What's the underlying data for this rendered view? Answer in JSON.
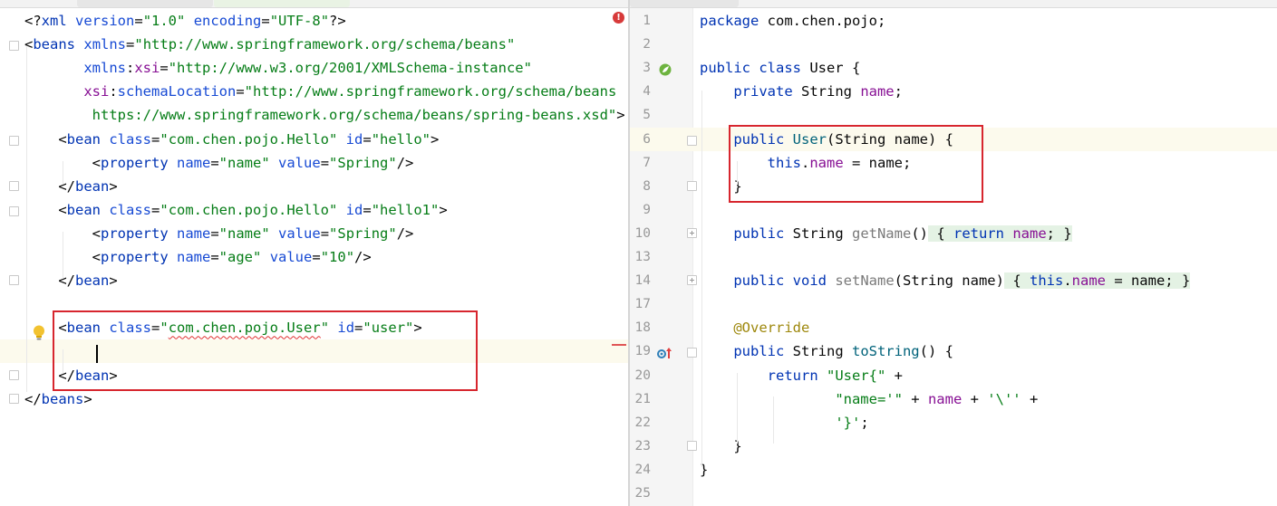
{
  "xml_editor": {
    "lines": [
      [
        {
          "t": "<?",
          "c": "x-bracket"
        },
        {
          "t": "xml",
          "c": "x-tag"
        },
        {
          "t": " ",
          "c": ""
        },
        {
          "t": "version",
          "c": "x-attr"
        },
        {
          "t": "=",
          "c": ""
        },
        {
          "t": "\"1.0\"",
          "c": "x-val"
        },
        {
          "t": " ",
          "c": ""
        },
        {
          "t": "encoding",
          "c": "x-attr"
        },
        {
          "t": "=",
          "c": ""
        },
        {
          "t": "\"UTF-8\"",
          "c": "x-val"
        },
        {
          "t": "?>",
          "c": "x-bracket"
        }
      ],
      [
        {
          "t": "<",
          "c": "x-bracket"
        },
        {
          "t": "beans",
          "c": "x-tag"
        },
        {
          "t": " ",
          "c": ""
        },
        {
          "t": "xmlns",
          "c": "x-attr"
        },
        {
          "t": "=",
          "c": ""
        },
        {
          "t": "\"http://www.springframework.org/schema/beans\"",
          "c": "x-val"
        }
      ],
      [
        {
          "t": "       ",
          "c": ""
        },
        {
          "t": "xmlns",
          "c": "x-attr"
        },
        {
          "t": ":",
          "c": ""
        },
        {
          "t": "xsi",
          "c": "x-ns"
        },
        {
          "t": "=",
          "c": ""
        },
        {
          "t": "\"http://www.w3.org/2001/XMLSchema-instance\"",
          "c": "x-val"
        }
      ],
      [
        {
          "t": "       ",
          "c": ""
        },
        {
          "t": "xsi",
          "c": "x-ns"
        },
        {
          "t": ":",
          "c": ""
        },
        {
          "t": "schemaLocation",
          "c": "x-attr"
        },
        {
          "t": "=",
          "c": ""
        },
        {
          "t": "\"http://www.springframework.org/schema/beans",
          "c": "x-val"
        }
      ],
      [
        {
          "t": "        ",
          "c": ""
        },
        {
          "t": "https://www.springframework.org/schema/beans/spring-beans.xsd\"",
          "c": "x-val"
        },
        {
          "t": ">",
          "c": "x-bracket"
        }
      ],
      [
        {
          "t": "    <",
          "c": "x-bracket"
        },
        {
          "t": "bean",
          "c": "x-tag"
        },
        {
          "t": " ",
          "c": ""
        },
        {
          "t": "class",
          "c": "x-attr"
        },
        {
          "t": "=",
          "c": ""
        },
        {
          "t": "\"com.chen.pojo.Hello\"",
          "c": "x-val"
        },
        {
          "t": " ",
          "c": ""
        },
        {
          "t": "id",
          "c": "x-attr"
        },
        {
          "t": "=",
          "c": ""
        },
        {
          "t": "\"hello\"",
          "c": "x-val"
        },
        {
          "t": ">",
          "c": "x-bracket"
        }
      ],
      [
        {
          "t": "        <",
          "c": "x-bracket"
        },
        {
          "t": "property",
          "c": "x-tag"
        },
        {
          "t": " ",
          "c": ""
        },
        {
          "t": "name",
          "c": "x-attr"
        },
        {
          "t": "=",
          "c": ""
        },
        {
          "t": "\"name\"",
          "c": "x-val"
        },
        {
          "t": " ",
          "c": ""
        },
        {
          "t": "value",
          "c": "x-attr"
        },
        {
          "t": "=",
          "c": ""
        },
        {
          "t": "\"Spring\"",
          "c": "x-val"
        },
        {
          "t": "/>",
          "c": "x-bracket"
        }
      ],
      [
        {
          "t": "    </",
          "c": "x-bracket"
        },
        {
          "t": "bean",
          "c": "x-tag"
        },
        {
          "t": ">",
          "c": "x-bracket"
        }
      ],
      [
        {
          "t": "    <",
          "c": "x-bracket"
        },
        {
          "t": "bean",
          "c": "x-tag"
        },
        {
          "t": " ",
          "c": ""
        },
        {
          "t": "class",
          "c": "x-attr"
        },
        {
          "t": "=",
          "c": ""
        },
        {
          "t": "\"com.chen.pojo.Hello\"",
          "c": "x-val"
        },
        {
          "t": " ",
          "c": ""
        },
        {
          "t": "id",
          "c": "x-attr"
        },
        {
          "t": "=",
          "c": ""
        },
        {
          "t": "\"hello1\"",
          "c": "x-val"
        },
        {
          "t": ">",
          "c": "x-bracket"
        }
      ],
      [
        {
          "t": "        <",
          "c": "x-bracket"
        },
        {
          "t": "property",
          "c": "x-tag"
        },
        {
          "t": " ",
          "c": ""
        },
        {
          "t": "name",
          "c": "x-attr"
        },
        {
          "t": "=",
          "c": ""
        },
        {
          "t": "\"name\"",
          "c": "x-val"
        },
        {
          "t": " ",
          "c": ""
        },
        {
          "t": "value",
          "c": "x-attr"
        },
        {
          "t": "=",
          "c": ""
        },
        {
          "t": "\"Spring\"",
          "c": "x-val"
        },
        {
          "t": "/>",
          "c": "x-bracket"
        }
      ],
      [
        {
          "t": "        <",
          "c": "x-bracket"
        },
        {
          "t": "property",
          "c": "x-tag"
        },
        {
          "t": " ",
          "c": ""
        },
        {
          "t": "name",
          "c": "x-attr"
        },
        {
          "t": "=",
          "c": ""
        },
        {
          "t": "\"age\"",
          "c": "x-val"
        },
        {
          "t": " ",
          "c": ""
        },
        {
          "t": "value",
          "c": "x-attr"
        },
        {
          "t": "=",
          "c": ""
        },
        {
          "t": "\"10\"",
          "c": "x-val"
        },
        {
          "t": "/>",
          "c": "x-bracket"
        }
      ],
      [
        {
          "t": "    </",
          "c": "x-bracket"
        },
        {
          "t": "bean",
          "c": "x-tag"
        },
        {
          "t": ">",
          "c": "x-bracket"
        }
      ],
      [],
      [
        {
          "t": "    <",
          "c": "x-bracket"
        },
        {
          "t": "bean",
          "c": "x-tag"
        },
        {
          "t": " ",
          "c": ""
        },
        {
          "t": "class",
          "c": "x-attr"
        },
        {
          "t": "=",
          "c": ""
        },
        {
          "t": "\"",
          "c": "x-val"
        },
        {
          "t": "com.chen.pojo.User",
          "c": "x-val x-squiggle"
        },
        {
          "t": "\"",
          "c": "x-val"
        },
        {
          "t": " ",
          "c": ""
        },
        {
          "t": "id",
          "c": "x-attr"
        },
        {
          "t": "=",
          "c": ""
        },
        {
          "t": "\"user\"",
          "c": "x-val"
        },
        {
          "t": ">",
          "c": "x-bracket"
        }
      ],
      [],
      [
        {
          "t": "    </",
          "c": "x-bracket"
        },
        {
          "t": "bean",
          "c": "x-tag"
        },
        {
          "t": ">",
          "c": "x-bracket"
        }
      ],
      [
        {
          "t": "</",
          "c": "x-bracket"
        },
        {
          "t": "beans",
          "c": "x-tag"
        },
        {
          "t": ">",
          "c": "x-bracket"
        }
      ]
    ],
    "error_marker": "!"
  },
  "java_editor": {
    "lines": [
      {
        "n": "1",
        "s": [
          {
            "t": "package",
            "c": "k"
          },
          {
            "t": " com.chen.pojo;",
            "c": ""
          }
        ]
      },
      {
        "n": "2",
        "s": []
      },
      {
        "n": "3",
        "s": [
          {
            "t": "public class",
            "c": "k"
          },
          {
            "t": " User {",
            "c": ""
          }
        ]
      },
      {
        "n": "4",
        "s": [
          {
            "t": "    ",
            "c": ""
          },
          {
            "t": "private",
            "c": "k"
          },
          {
            "t": " String ",
            "c": ""
          },
          {
            "t": "name",
            "c": "f"
          },
          {
            "t": ";",
            "c": ""
          }
        ]
      },
      {
        "n": "5",
        "s": []
      },
      {
        "n": "6",
        "s": [
          {
            "t": "    ",
            "c": ""
          },
          {
            "t": "public",
            "c": "k"
          },
          {
            "t": " ",
            "c": ""
          },
          {
            "t": "User",
            "c": "m"
          },
          {
            "t": "(String name) {",
            "c": ""
          }
        ]
      },
      {
        "n": "7",
        "s": [
          {
            "t": "        ",
            "c": ""
          },
          {
            "t": "this",
            "c": "k"
          },
          {
            "t": ".",
            "c": ""
          },
          {
            "t": "name",
            "c": "f"
          },
          {
            "t": " = name;",
            "c": ""
          }
        ]
      },
      {
        "n": "8",
        "s": [
          {
            "t": "    }",
            "c": ""
          }
        ]
      },
      {
        "n": "9",
        "s": []
      },
      {
        "n": "10",
        "s": [
          {
            "t": "    ",
            "c": ""
          },
          {
            "t": "public",
            "c": "k"
          },
          {
            "t": " String ",
            "c": ""
          },
          {
            "t": "getName",
            "c": "mc"
          },
          {
            "t": "()",
            "c": ""
          },
          {
            "t": " { ",
            "c": "fold-region"
          },
          {
            "t": "return",
            "c": "k fold-region"
          },
          {
            "t": " ",
            "c": "fold-region"
          },
          {
            "t": "name",
            "c": "f fold-region"
          },
          {
            "t": "; }",
            "c": "fold-region"
          }
        ]
      },
      {
        "n": "13",
        "s": []
      },
      {
        "n": "14",
        "s": [
          {
            "t": "    ",
            "c": ""
          },
          {
            "t": "public void",
            "c": "k"
          },
          {
            "t": " ",
            "c": ""
          },
          {
            "t": "setName",
            "c": "mc"
          },
          {
            "t": "(String name)",
            "c": ""
          },
          {
            "t": " { ",
            "c": "fold-region"
          },
          {
            "t": "this",
            "c": "k fold-region"
          },
          {
            "t": ".",
            "c": "fold-region"
          },
          {
            "t": "name",
            "c": "f fold-region"
          },
          {
            "t": " = name; }",
            "c": "fold-region"
          }
        ]
      },
      {
        "n": "17",
        "s": []
      },
      {
        "n": "18",
        "s": [
          {
            "t": "    ",
            "c": ""
          },
          {
            "t": "@Override",
            "c": "an"
          }
        ]
      },
      {
        "n": "19",
        "s": [
          {
            "t": "    ",
            "c": ""
          },
          {
            "t": "public",
            "c": "k"
          },
          {
            "t": " String ",
            "c": ""
          },
          {
            "t": "toString",
            "c": "m"
          },
          {
            "t": "() {",
            "c": ""
          }
        ]
      },
      {
        "n": "20",
        "s": [
          {
            "t": "        ",
            "c": ""
          },
          {
            "t": "return",
            "c": "k"
          },
          {
            "t": " ",
            "c": ""
          },
          {
            "t": "\"User{\"",
            "c": "s"
          },
          {
            "t": " +",
            "c": ""
          }
        ]
      },
      {
        "n": "21",
        "s": [
          {
            "t": "                ",
            "c": ""
          },
          {
            "t": "\"name='\"",
            "c": "s"
          },
          {
            "t": " + ",
            "c": ""
          },
          {
            "t": "name",
            "c": "f"
          },
          {
            "t": " + ",
            "c": ""
          },
          {
            "t": "'\\''",
            "c": "s"
          },
          {
            "t": " +",
            "c": ""
          }
        ]
      },
      {
        "n": "22",
        "s": [
          {
            "t": "                ",
            "c": ""
          },
          {
            "t": "'}'",
            "c": "s"
          },
          {
            "t": ";",
            "c": ""
          }
        ]
      },
      {
        "n": "23",
        "s": [
          {
            "t": "    }",
            "c": ""
          }
        ]
      },
      {
        "n": "24",
        "s": [
          {
            "t": "}",
            "c": ""
          }
        ]
      },
      {
        "n": "25",
        "s": []
      }
    ]
  }
}
